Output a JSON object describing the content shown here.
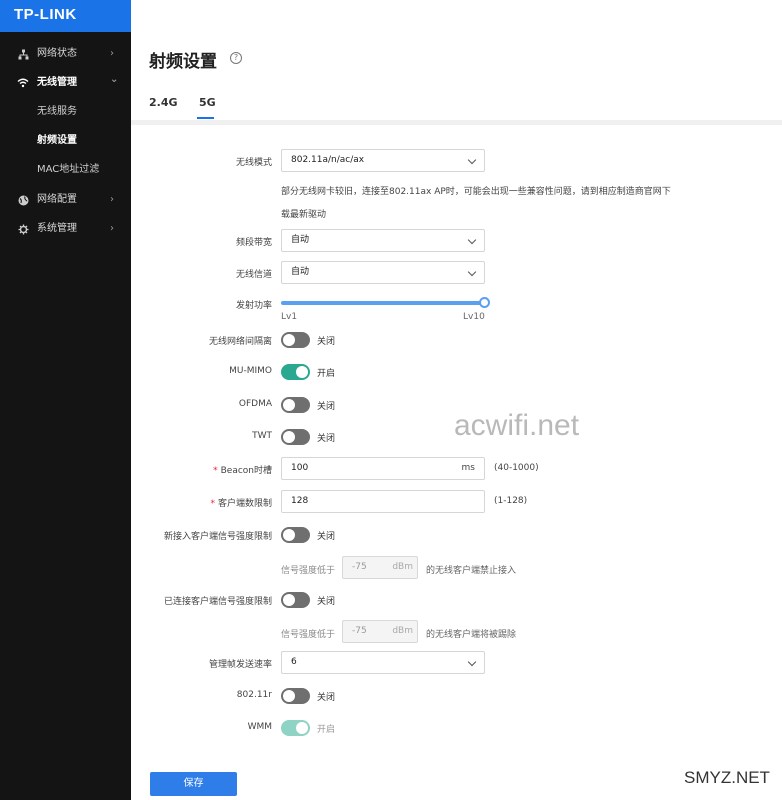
{
  "brand": {
    "logo": "TP-LINK",
    "color": "#1b73e8"
  },
  "sidebar": {
    "items": [
      {
        "label": "网络状态",
        "icon": "network-status-icon"
      },
      {
        "label": "无线管理",
        "icon": "wifi-icon"
      },
      {
        "label": "网络配置",
        "icon": "globe-icon"
      },
      {
        "label": "系统管理",
        "icon": "gear-icon"
      }
    ],
    "sub_items": [
      "无线服务",
      "射频设置",
      "MAC地址过滤"
    ],
    "chevron_right": "›",
    "chevron_down": "⌄"
  },
  "page": {
    "title": "射频设置",
    "help": "?"
  },
  "tabs": [
    {
      "label": "2.4G"
    },
    {
      "label": "5G",
      "active": true
    }
  ],
  "form": {
    "wireless_mode": {
      "label": "无线模式",
      "value": "802.11a/n/ac/ax"
    },
    "mode_note_line1": "部分无线网卡较旧，连接至802.11ax AP时，可能会出现一些兼容性问题，请到相应制造商官网下",
    "mode_note_line2": "载最新驱动",
    "bandwidth": {
      "label": "频段带宽",
      "value": "自动"
    },
    "channel": {
      "label": "无线信道",
      "value": "自动"
    },
    "tx_power": {
      "label": "发射功率",
      "min_label": "Lv1",
      "max_label": "Lv10",
      "level": 10
    },
    "isolation": {
      "label": "无线网络间隔离",
      "state": "关闭"
    },
    "mu_mimo": {
      "label": "MU-MIMO",
      "state": "开启"
    },
    "ofdma": {
      "label": "OFDMA",
      "state": "关闭"
    },
    "twt": {
      "label": "TWT",
      "state": "关闭"
    },
    "beacon": {
      "required": "*",
      "label": "Beacon时槽",
      "value": "100",
      "unit": "ms",
      "range": "(40-1000)"
    },
    "client_limit": {
      "required": "*",
      "label": "客户端数限制",
      "value": "128",
      "range": "(1-128)"
    },
    "new_client_signal": {
      "label": "新接入客户端信号强度限制",
      "state": "关闭",
      "pre": "信号强度低于",
      "value": "-75",
      "unit": "dBm",
      "post": "的无线客户端禁止接入"
    },
    "connected_client_signal": {
      "label": "已连接客户端信号强度限制",
      "state": "关闭",
      "pre": "信号强度低于",
      "value": "-75",
      "unit": "dBm",
      "post": "的无线客户端将被踢除"
    },
    "mgmt_rate": {
      "label": "管理帧发送速率",
      "value": "6"
    },
    "r80211r": {
      "label": "802.11r",
      "state": "关闭"
    },
    "wmm": {
      "label": "WMM",
      "state": "开启"
    }
  },
  "save_button": "保存",
  "watermarks": {
    "center": "acwifi.net",
    "corner": "SMYZ.NET"
  },
  "colors": {
    "toggle_on": "#2aa890",
    "toggle_off": "#6f6f6f",
    "slider": "#5b9ff0",
    "save": "#2e7de9"
  }
}
